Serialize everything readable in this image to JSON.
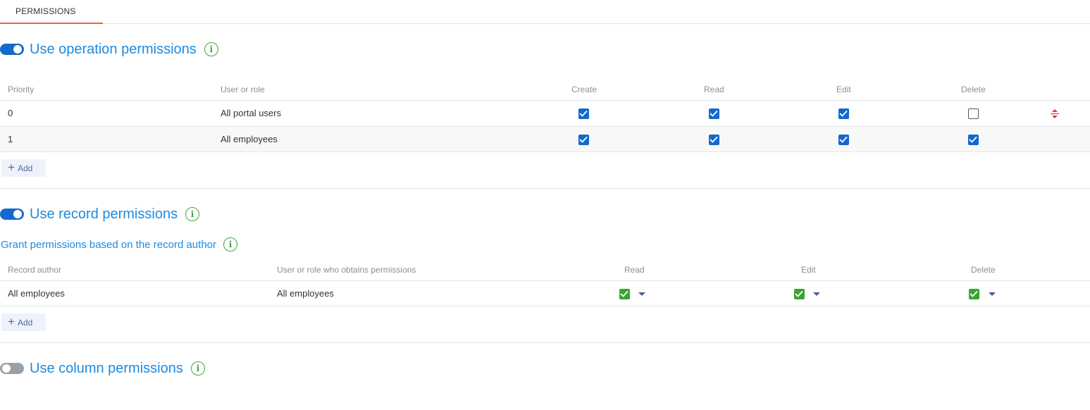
{
  "tabs": [
    {
      "label": "PERMISSIONS",
      "active": true
    }
  ],
  "operation": {
    "title": "Use operation permissions",
    "enabled": true,
    "columns": [
      "Priority",
      "User or role",
      "Create",
      "Read",
      "Edit",
      "Delete"
    ],
    "rows": [
      {
        "priority": "0",
        "role": "All portal users",
        "create": true,
        "read": true,
        "edit": true,
        "delete": false
      },
      {
        "priority": "1",
        "role": "All employees",
        "create": true,
        "read": true,
        "edit": true,
        "delete": true
      }
    ],
    "add_label": "Add"
  },
  "record": {
    "title": "Use record permissions",
    "enabled": true,
    "subtitle": "Grant permissions based on the record author",
    "columns": [
      "Record author",
      "User or role who obtains permissions",
      "Read",
      "Edit",
      "Delete"
    ],
    "rows": [
      {
        "author": "All employees",
        "grantee": "All employees",
        "read": true,
        "edit": true,
        "delete": true
      }
    ],
    "add_label": "Add"
  },
  "column": {
    "title": "Use column permissions",
    "enabled": false
  },
  "colors": {
    "accent_tab": "#f0623c",
    "title_blue": "#1d8ae0",
    "toggle_on": "#1369cc",
    "checkbox_blue": "#1369cc",
    "checkbox_green": "#3aa531",
    "info_green": "#3ea73b"
  }
}
